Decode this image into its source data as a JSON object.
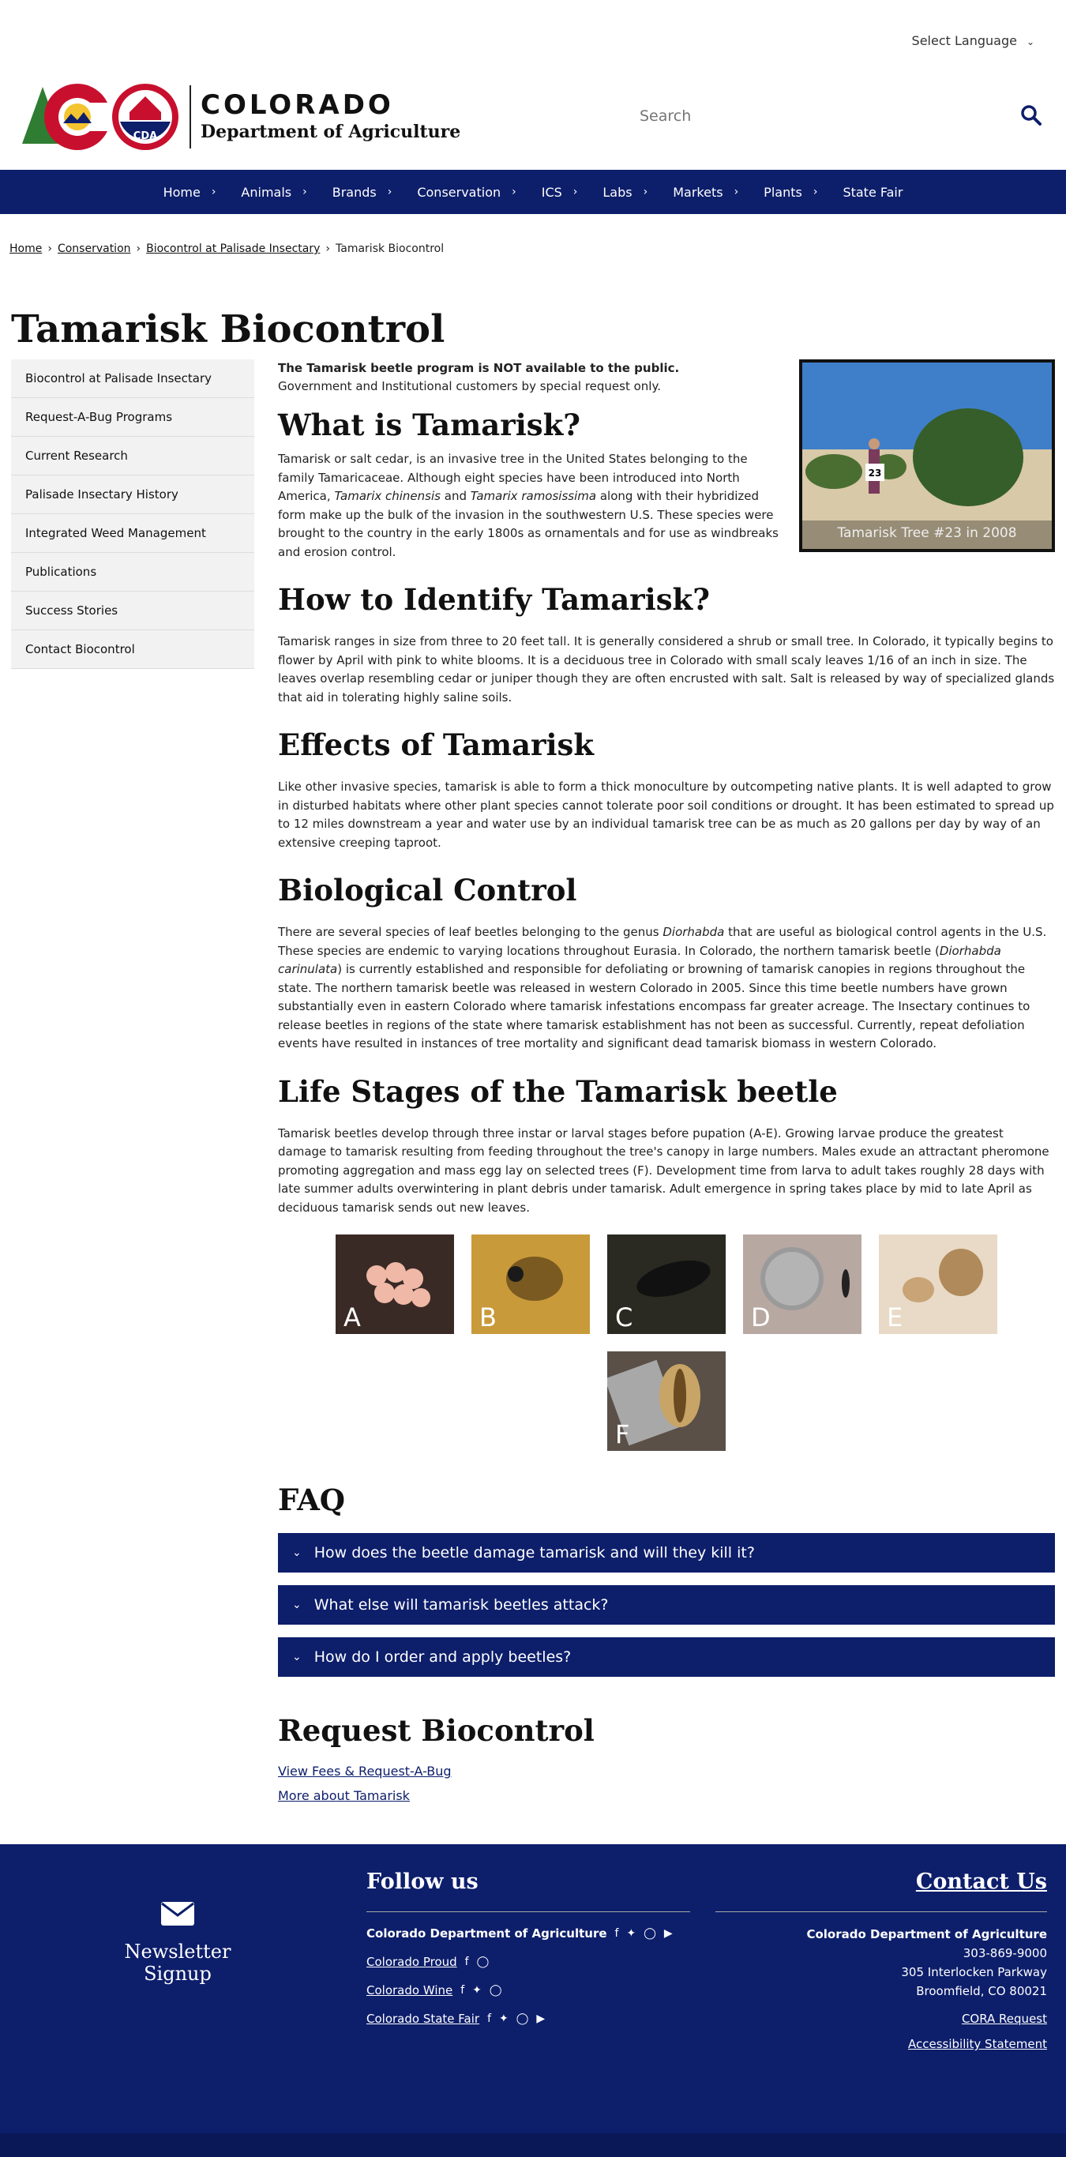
{
  "colors": {
    "brand_navy": "#0d1e6b",
    "red": "#c8102e",
    "green": "#2e7d32",
    "gold": "#f4c430"
  },
  "language": {
    "label": "Select Language"
  },
  "logo": {
    "line1": "COLORADO",
    "line2": "Department of Agriculture",
    "seal_text": "CDA"
  },
  "search": {
    "placeholder": "Search"
  },
  "nav": [
    {
      "label": "Home"
    },
    {
      "label": "Animals"
    },
    {
      "label": "Brands"
    },
    {
      "label": "Conservation"
    },
    {
      "label": "ICS"
    },
    {
      "label": "Labs"
    },
    {
      "label": "Markets"
    },
    {
      "label": "Plants"
    },
    {
      "label": "State Fair"
    }
  ],
  "breadcrumb": {
    "home": "Home",
    "conservation": "Conservation",
    "palisade": "Biocontrol at Palisade Insectary",
    "current": "Tamarisk Biocontrol"
  },
  "page_title": "Tamarisk Biocontrol",
  "sidebar": {
    "items": [
      {
        "label": "Biocontrol at Palisade Insectary"
      },
      {
        "label": "Request-A-Bug Programs"
      },
      {
        "label": "Current Research"
      },
      {
        "label": "Palisade Insectary History"
      },
      {
        "label": "Integrated Weed Management"
      },
      {
        "label": "Publications"
      },
      {
        "label": "Success Stories"
      },
      {
        "label": "Contact Biocontrol"
      }
    ]
  },
  "intro": {
    "bold": "The Tamarisk beetle program is NOT available to the public.",
    "text": "Government and Institutional customers by special request only."
  },
  "photo": {
    "caption": "Tamarisk Tree #23 in 2008",
    "sign": "23"
  },
  "what": {
    "heading": "What is Tamarisk?",
    "p1": "Tamarisk or salt cedar, is an invasive tree in the United States belonging to the family Tamaricaceae. Although eight species have been introduced into North America,",
    "sp1": "Tamarix chinensis",
    "and": "and",
    "sp2": "Tamarix ramosissima",
    "p2": "along with their hybridized form make up the bulk of the invasion in the southwestern U.S. These species were brought to the country in the early 1800s as ornamentals and for use as windbreaks and erosion control."
  },
  "identify": {
    "heading": "How to Identify Tamarisk?",
    "text": "Tamarisk ranges in size from three to 20 feet tall. It is generally considered a shrub or small tree. In Colorado, it typically begins to flower by April with pink to white blooms. It is a deciduous tree in Colorado with small scaly leaves 1/16 of an inch in size. The leaves overlap resembling cedar or juniper though they are often encrusted with salt. Salt is released by way of specialized glands that aid in tolerating highly saline soils."
  },
  "effects": {
    "heading": "Effects of Tamarisk",
    "text": "Like other invasive species, tamarisk is able to form a thick monoculture by outcompeting native plants. It is well adapted to grow in disturbed habitats where other plant species cannot tolerate poor soil conditions or drought. It has been estimated to spread up to 12 miles downstream a year and water use by an individual tamarisk tree can be as much as 20 gallons per day by way of an extensive creeping taproot."
  },
  "bio": {
    "heading": "Biological Control",
    "p1": "There are several species of leaf beetles belonging to the genus",
    "genus": "Diorhabda",
    "p2": "that are useful as biological control agents in the U.S. These species are endemic to varying locations throughout Eurasia. In Colorado, the northern tamarisk beetle (",
    "species": "Diorhabda carinulata",
    "p3": ") is currently established and responsible for defoliating or browning of tamarisk canopies in regions throughout the state. The northern tamarisk beetle was released in western Colorado in 2005. Since this time beetle numbers have grown substantially even in eastern Colorado where tamarisk infestations encompass far greater acreage. The Insectary continues to release beetles in regions of the state where tamarisk establishment has not been as successful. Currently, repeat defoliation events have resulted in instances of tree mortality and significant dead tamarisk biomass in western Colorado."
  },
  "life": {
    "heading": "Life Stages of the Tamarisk beetle",
    "text": "Tamarisk beetles develop through three instar or larval stages before pupation (A-E). Growing larvae produce the greatest damage to tamarisk resulting from feeding throughout the tree's canopy in large numbers. Males exude an attractant pheromone promoting aggregation and mass egg lay on selected trees (F). Development time from larva to adult takes roughly 28 days with late summer adults overwintering in plant debris under tamarisk. Adult emergence in spring takes place by mid to late April as deciduous tamarisk sends out new leaves.",
    "images": [
      {
        "label": "A"
      },
      {
        "label": "B"
      },
      {
        "label": "C"
      },
      {
        "label": "D"
      },
      {
        "label": "E"
      },
      {
        "label": "F"
      }
    ]
  },
  "faq": {
    "heading": "FAQ",
    "items": [
      {
        "q": "How does the beetle damage tamarisk and will they kill it?"
      },
      {
        "q": "What else will tamarisk beetles attack?"
      },
      {
        "q": "How do I order and apply beetles?"
      }
    ]
  },
  "request": {
    "heading": "Request Biocontrol",
    "link1": "View Fees & Request-A-Bug",
    "link2": "More about Tamarisk"
  },
  "footer": {
    "newsletter": "Newsletter Signup",
    "follow_heading": "Follow us",
    "follow": [
      {
        "name": "Colorado Department of Agriculture"
      },
      {
        "name": "Colorado Proud"
      },
      {
        "name": "Colorado Wine"
      },
      {
        "name": "Colorado State Fair"
      }
    ],
    "contact_heading": "Contact Us",
    "org": "Colorado Department of Agriculture",
    "phone": "303-869-9000",
    "street": "305 Interlocken Parkway",
    "city": "Broomfield, CO 80021",
    "cora": "CORA Request",
    "access": "Accessibility Statement"
  }
}
